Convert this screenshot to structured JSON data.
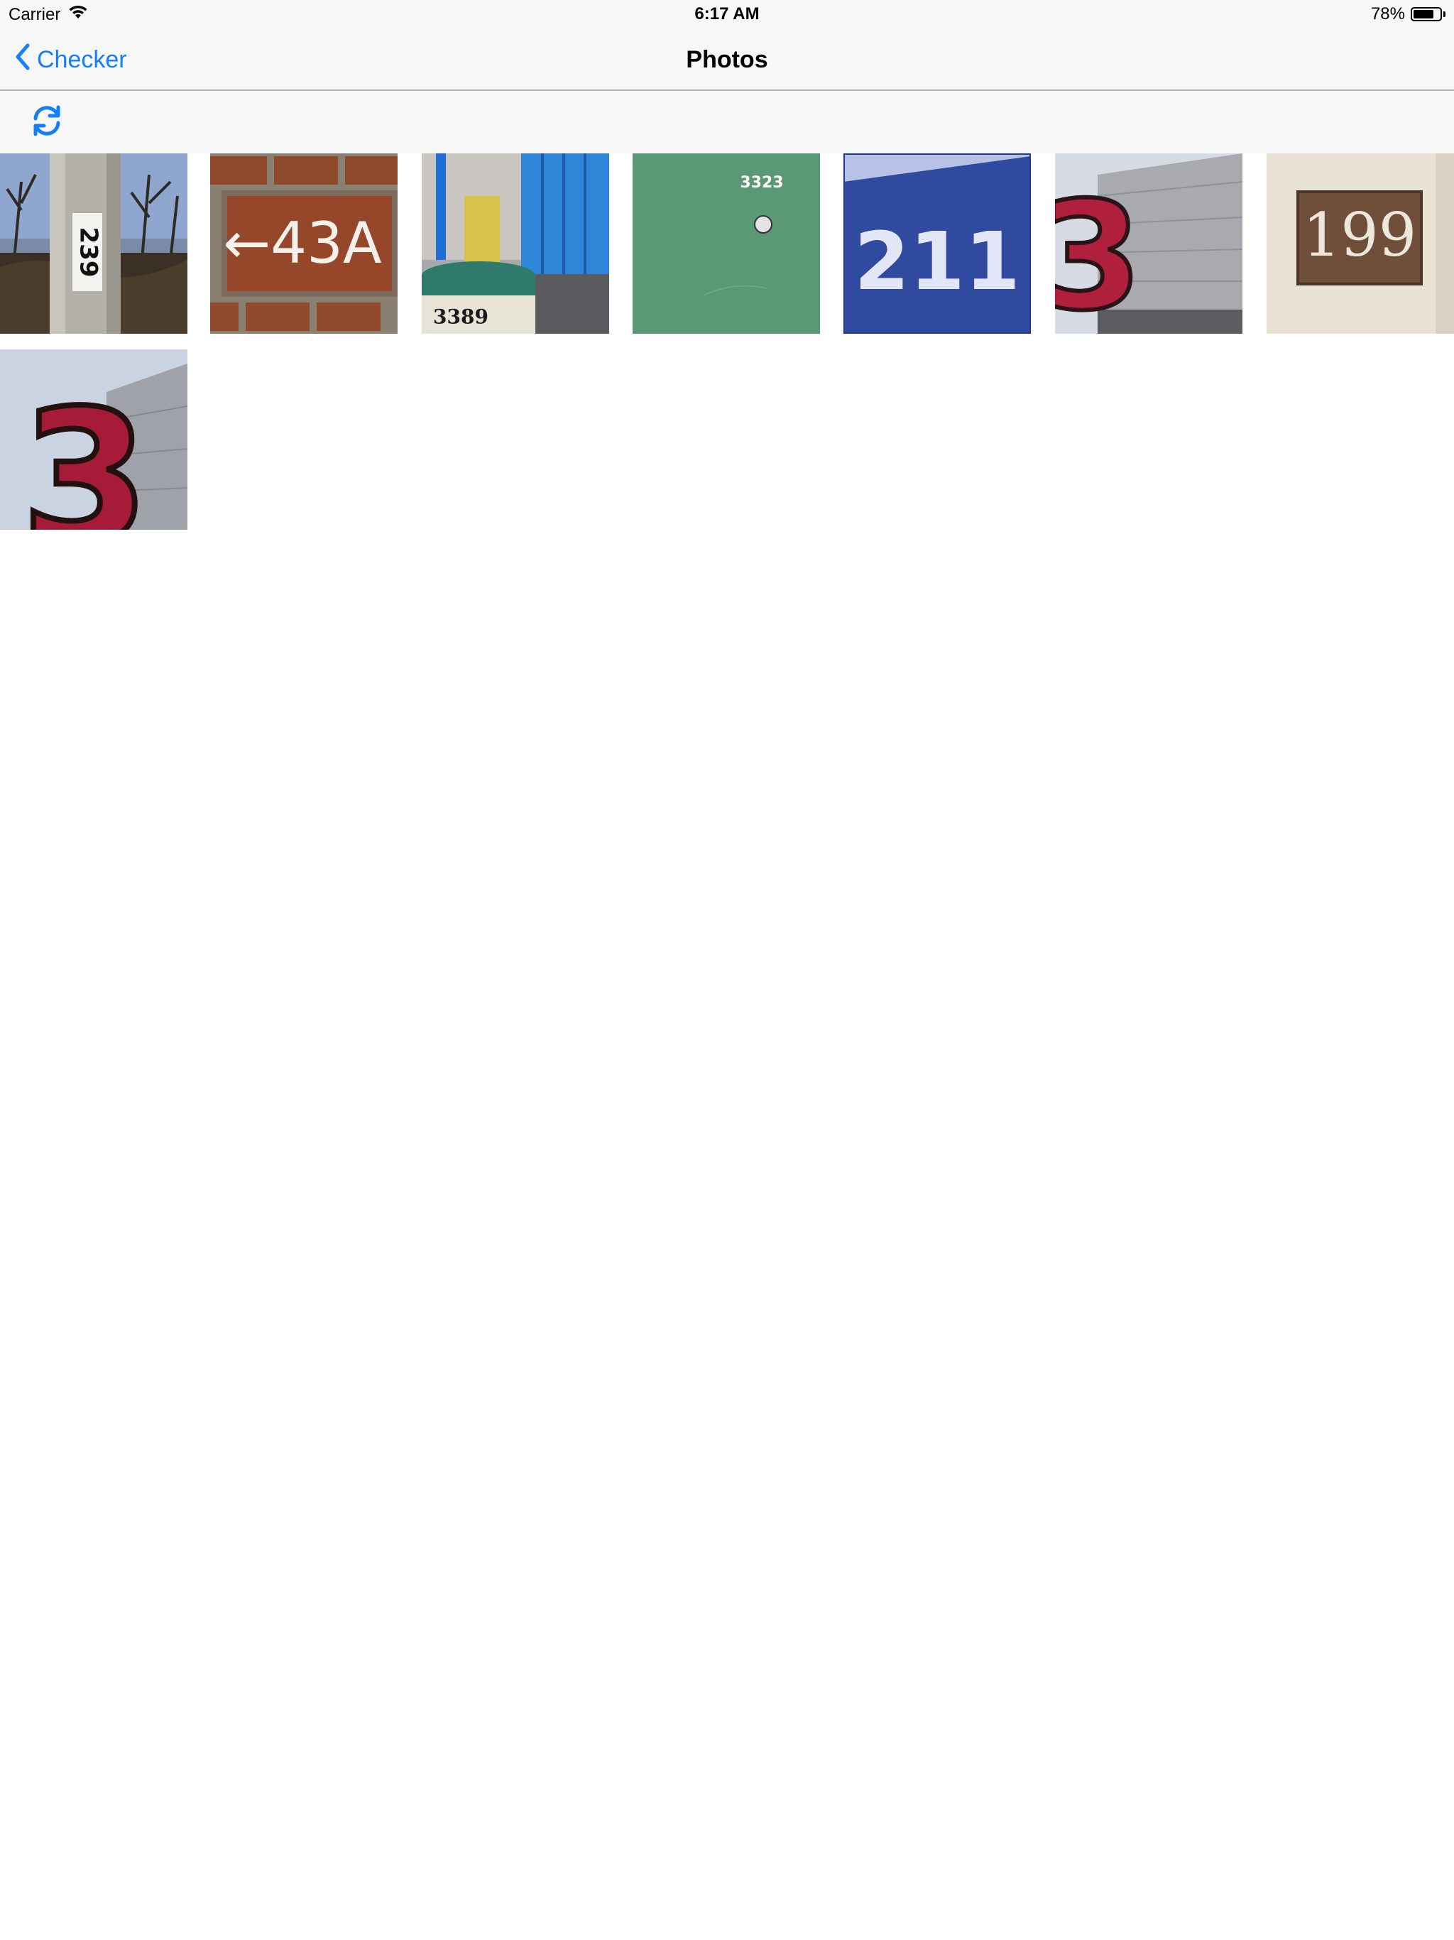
{
  "status_bar": {
    "carrier": "Carrier",
    "time": "6:17 AM",
    "battery_text": "78%",
    "battery_level": 0.78
  },
  "nav": {
    "back_label": "Checker",
    "title": "Photos",
    "accent_color": "#147efb"
  },
  "toolbar": {
    "refresh_icon": "refresh-icon"
  },
  "photos": [
    {
      "label": "239",
      "scene": "pole"
    },
    {
      "label": "←43A",
      "scene": "brick"
    },
    {
      "label": "3389",
      "scene": "street"
    },
    {
      "label": "3323",
      "scene": "green-door"
    },
    {
      "label": "211",
      "scene": "blue-sign"
    },
    {
      "label": "3",
      "scene": "building-3"
    },
    {
      "label": "199",
      "scene": "plaque"
    },
    {
      "label": "3",
      "scene": "building-3-closeup"
    }
  ]
}
